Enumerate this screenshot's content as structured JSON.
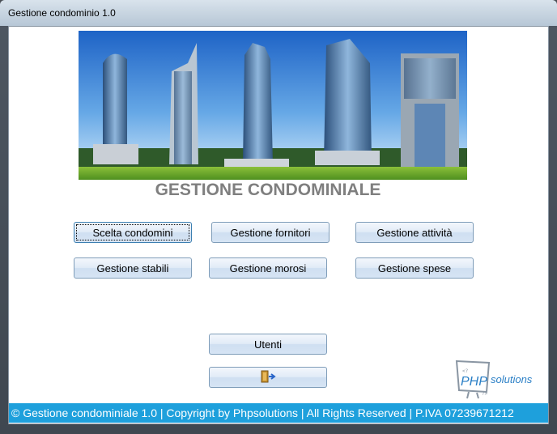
{
  "window": {
    "title": "Gestione condominio 1.0"
  },
  "header": {
    "title": "GESTIONE CONDOMINIALE"
  },
  "buttons": {
    "scelta_condomini": "Scelta condomini",
    "gestione_fornitori": "Gestione fornitori",
    "gestione_attivita": "Gestione attività",
    "gestione_stabili": "Gestione stabili",
    "gestione_morosi": "Gestione morosi",
    "gestione_spese": "Gestione spese",
    "utenti": "Utenti",
    "exit_icon": "exit-door-icon"
  },
  "logo": {
    "text_php": "PHP",
    "text_solutions": "solutions",
    "icon": "monitor-logo-icon"
  },
  "footer": {
    "text": "© Gestione condominiale 1.0 | Copyright by Phpsolutions |  All Rights Reserved | P.IVA 07239671212"
  },
  "colors": {
    "footer_bg": "#1ea0dc",
    "heading": "#7f7f7f",
    "button_border": "#7f9db9"
  }
}
